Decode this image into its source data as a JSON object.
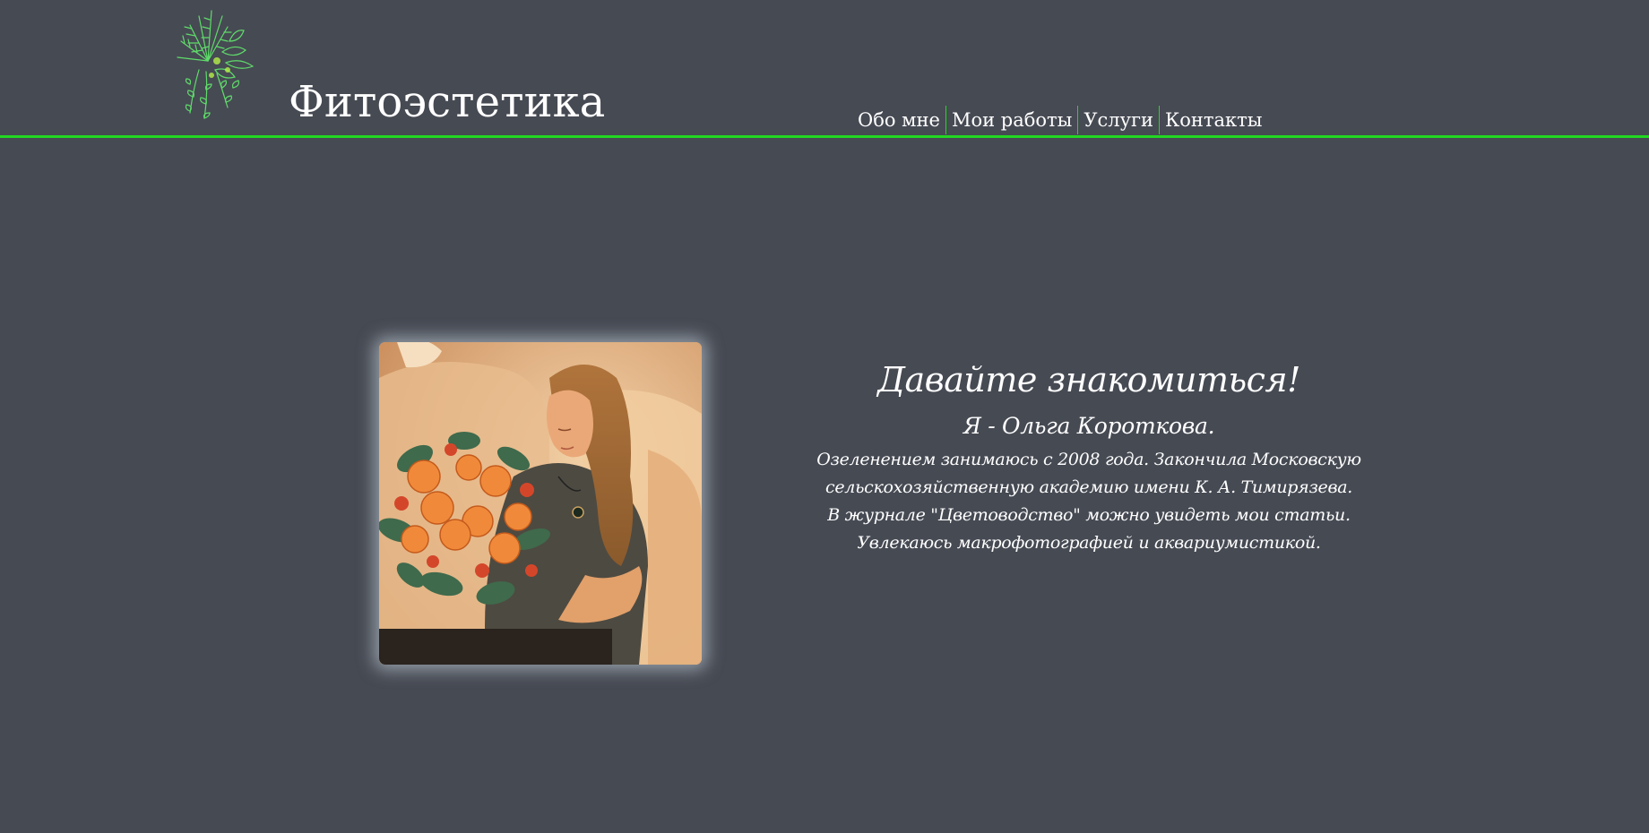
{
  "header": {
    "title": "Фитоэстетика",
    "logo_icon": "plant-logo-icon",
    "accent_color": "#22d822"
  },
  "nav": {
    "items": [
      {
        "label": "Обо мне"
      },
      {
        "label": "Мои работы"
      },
      {
        "label": "Услуги"
      },
      {
        "label": "Контакты"
      }
    ]
  },
  "main": {
    "photo": {
      "description_icon": "woman-with-bouquet-photo"
    },
    "heading": "Давайте знакомиться!",
    "name_line": "Я - Ольга Короткова.",
    "lines": [
      "Озеленением занимаюсь с 2008 года. Закончила Московскую",
      "сельскохозяйственную академию имени К. А. Тимирязева.",
      "В журнале \"Цветоводство\" можно увидеть мои статьи.",
      "Увлекаюсь макрофотографией и аквариумистикой."
    ]
  },
  "colors": {
    "background": "#464a53",
    "text": "#ffffff",
    "accent": "#22d822"
  }
}
